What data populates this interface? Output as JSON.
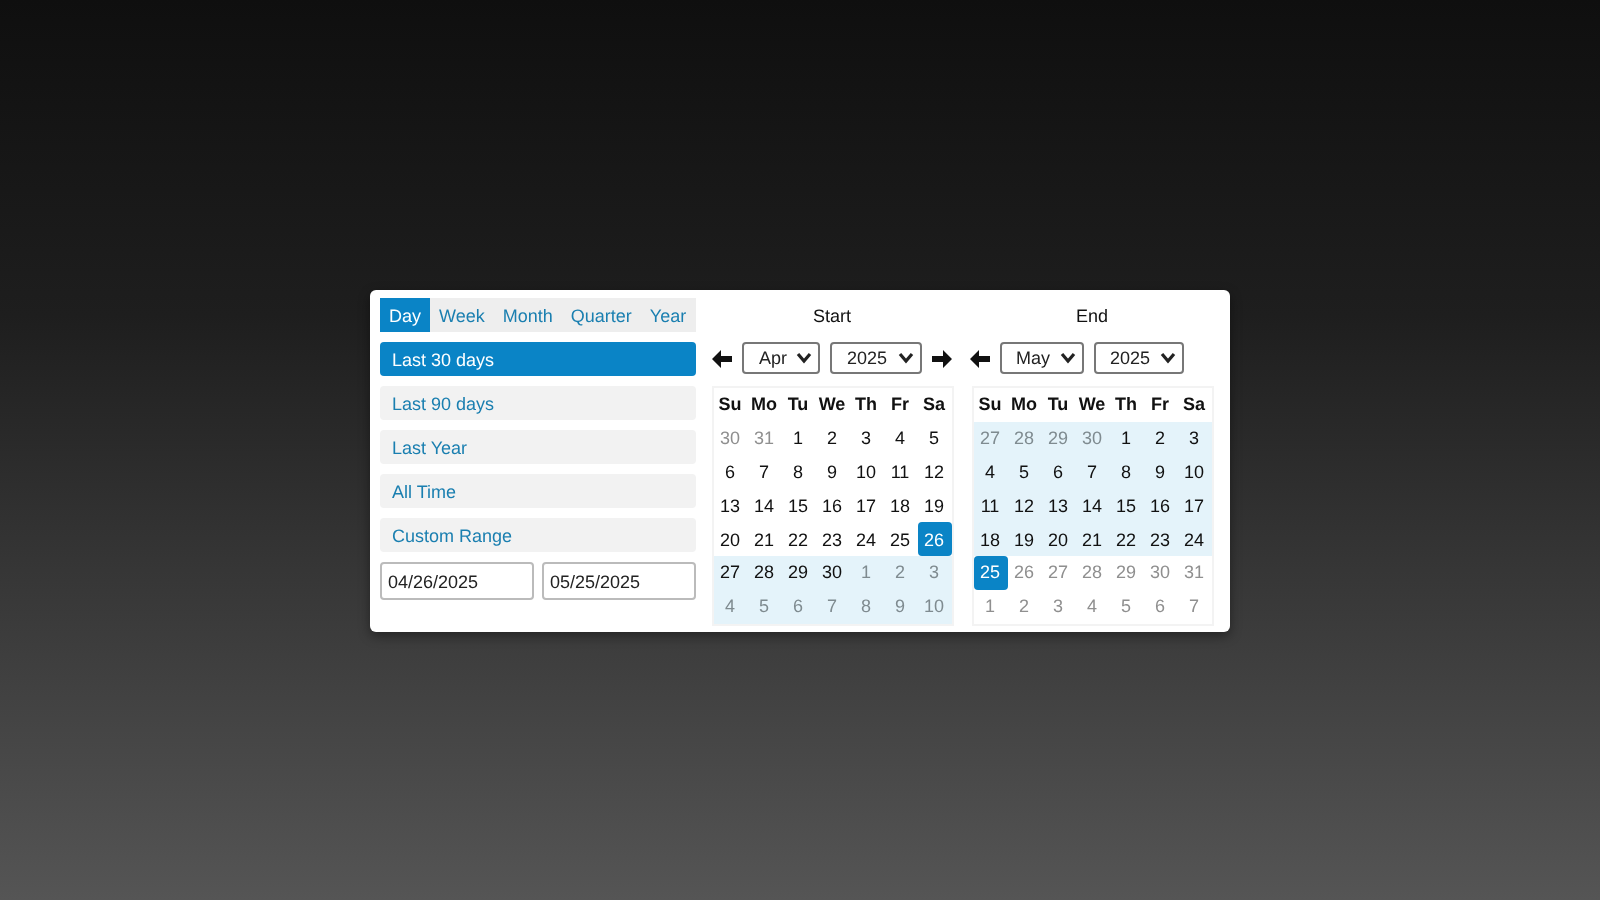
{
  "tabs": [
    {
      "label": "Day",
      "selected": true
    },
    {
      "label": "Week",
      "selected": false
    },
    {
      "label": "Month",
      "selected": false
    },
    {
      "label": "Quarter",
      "selected": false
    },
    {
      "label": "Year",
      "selected": false
    }
  ],
  "ranges": [
    {
      "label": "Last 30 days",
      "selected": true
    },
    {
      "label": "Last 90 days",
      "selected": false
    },
    {
      "label": "Last Year",
      "selected": false
    },
    {
      "label": "All Time",
      "selected": false
    },
    {
      "label": "Custom Range",
      "selected": false
    }
  ],
  "start_input": {
    "value": "04/26/2025"
  },
  "end_input": {
    "value": "05/25/2025"
  },
  "calendars": [
    {
      "title": "Start",
      "month": "Apr",
      "year": "2025",
      "prev_arrow": true,
      "next_arrow": true,
      "weekdays": [
        "Su",
        "Mo",
        "Tu",
        "We",
        "Th",
        "Fr",
        "Sa"
      ],
      "days": [
        {
          "day": "30",
          "outside": true,
          "in_range": false,
          "selected": false
        },
        {
          "day": "31",
          "outside": true,
          "in_range": false,
          "selected": false
        },
        {
          "day": "1",
          "outside": false,
          "in_range": false,
          "selected": false
        },
        {
          "day": "2",
          "outside": false,
          "in_range": false,
          "selected": false
        },
        {
          "day": "3",
          "outside": false,
          "in_range": false,
          "selected": false
        },
        {
          "day": "4",
          "outside": false,
          "in_range": false,
          "selected": false
        },
        {
          "day": "5",
          "outside": false,
          "in_range": false,
          "selected": false
        },
        {
          "day": "6",
          "outside": false,
          "in_range": false,
          "selected": false
        },
        {
          "day": "7",
          "outside": false,
          "in_range": false,
          "selected": false
        },
        {
          "day": "8",
          "outside": false,
          "in_range": false,
          "selected": false
        },
        {
          "day": "9",
          "outside": false,
          "in_range": false,
          "selected": false
        },
        {
          "day": "10",
          "outside": false,
          "in_range": false,
          "selected": false
        },
        {
          "day": "11",
          "outside": false,
          "in_range": false,
          "selected": false
        },
        {
          "day": "12",
          "outside": false,
          "in_range": false,
          "selected": false
        },
        {
          "day": "13",
          "outside": false,
          "in_range": false,
          "selected": false
        },
        {
          "day": "14",
          "outside": false,
          "in_range": false,
          "selected": false
        },
        {
          "day": "15",
          "outside": false,
          "in_range": false,
          "selected": false
        },
        {
          "day": "16",
          "outside": false,
          "in_range": false,
          "selected": false
        },
        {
          "day": "17",
          "outside": false,
          "in_range": false,
          "selected": false
        },
        {
          "day": "18",
          "outside": false,
          "in_range": false,
          "selected": false
        },
        {
          "day": "19",
          "outside": false,
          "in_range": false,
          "selected": false
        },
        {
          "day": "20",
          "outside": false,
          "in_range": false,
          "selected": false
        },
        {
          "day": "21",
          "outside": false,
          "in_range": false,
          "selected": false
        },
        {
          "day": "22",
          "outside": false,
          "in_range": false,
          "selected": false
        },
        {
          "day": "23",
          "outside": false,
          "in_range": false,
          "selected": false
        },
        {
          "day": "24",
          "outside": false,
          "in_range": false,
          "selected": false
        },
        {
          "day": "25",
          "outside": false,
          "in_range": false,
          "selected": false
        },
        {
          "day": "26",
          "outside": false,
          "in_range": false,
          "selected": true
        },
        {
          "day": "27",
          "outside": false,
          "in_range": true,
          "selected": false
        },
        {
          "day": "28",
          "outside": false,
          "in_range": true,
          "selected": false
        },
        {
          "day": "29",
          "outside": false,
          "in_range": true,
          "selected": false
        },
        {
          "day": "30",
          "outside": false,
          "in_range": true,
          "selected": false
        },
        {
          "day": "1",
          "outside": true,
          "in_range": true,
          "selected": false
        },
        {
          "day": "2",
          "outside": true,
          "in_range": true,
          "selected": false
        },
        {
          "day": "3",
          "outside": true,
          "in_range": true,
          "selected": false
        },
        {
          "day": "4",
          "outside": true,
          "in_range": true,
          "selected": false
        },
        {
          "day": "5",
          "outside": true,
          "in_range": true,
          "selected": false
        },
        {
          "day": "6",
          "outside": true,
          "in_range": true,
          "selected": false
        },
        {
          "day": "7",
          "outside": true,
          "in_range": true,
          "selected": false
        },
        {
          "day": "8",
          "outside": true,
          "in_range": true,
          "selected": false
        },
        {
          "day": "9",
          "outside": true,
          "in_range": true,
          "selected": false
        },
        {
          "day": "10",
          "outside": true,
          "in_range": true,
          "selected": false
        }
      ]
    },
    {
      "title": "End",
      "month": "May",
      "year": "2025",
      "prev_arrow": true,
      "next_arrow": false,
      "weekdays": [
        "Su",
        "Mo",
        "Tu",
        "We",
        "Th",
        "Fr",
        "Sa"
      ],
      "days": [
        {
          "day": "27",
          "outside": true,
          "in_range": true,
          "selected": false
        },
        {
          "day": "28",
          "outside": true,
          "in_range": true,
          "selected": false
        },
        {
          "day": "29",
          "outside": true,
          "in_range": true,
          "selected": false
        },
        {
          "day": "30",
          "outside": true,
          "in_range": true,
          "selected": false
        },
        {
          "day": "1",
          "outside": false,
          "in_range": true,
          "selected": false
        },
        {
          "day": "2",
          "outside": false,
          "in_range": true,
          "selected": false
        },
        {
          "day": "3",
          "outside": false,
          "in_range": true,
          "selected": false
        },
        {
          "day": "4",
          "outside": false,
          "in_range": true,
          "selected": false
        },
        {
          "day": "5",
          "outside": false,
          "in_range": true,
          "selected": false
        },
        {
          "day": "6",
          "outside": false,
          "in_range": true,
          "selected": false
        },
        {
          "day": "7",
          "outside": false,
          "in_range": true,
          "selected": false
        },
        {
          "day": "8",
          "outside": false,
          "in_range": true,
          "selected": false
        },
        {
          "day": "9",
          "outside": false,
          "in_range": true,
          "selected": false
        },
        {
          "day": "10",
          "outside": false,
          "in_range": true,
          "selected": false
        },
        {
          "day": "11",
          "outside": false,
          "in_range": true,
          "selected": false
        },
        {
          "day": "12",
          "outside": false,
          "in_range": true,
          "selected": false
        },
        {
          "day": "13",
          "outside": false,
          "in_range": true,
          "selected": false
        },
        {
          "day": "14",
          "outside": false,
          "in_range": true,
          "selected": false
        },
        {
          "day": "15",
          "outside": false,
          "in_range": true,
          "selected": false
        },
        {
          "day": "16",
          "outside": false,
          "in_range": true,
          "selected": false
        },
        {
          "day": "17",
          "outside": false,
          "in_range": true,
          "selected": false
        },
        {
          "day": "18",
          "outside": false,
          "in_range": true,
          "selected": false
        },
        {
          "day": "19",
          "outside": false,
          "in_range": true,
          "selected": false
        },
        {
          "day": "20",
          "outside": false,
          "in_range": true,
          "selected": false
        },
        {
          "day": "21",
          "outside": false,
          "in_range": true,
          "selected": false
        },
        {
          "day": "22",
          "outside": false,
          "in_range": true,
          "selected": false
        },
        {
          "day": "23",
          "outside": false,
          "in_range": true,
          "selected": false
        },
        {
          "day": "24",
          "outside": false,
          "in_range": true,
          "selected": false
        },
        {
          "day": "25",
          "outside": false,
          "in_range": false,
          "selected": true
        },
        {
          "day": "26",
          "outside": true,
          "in_range": false,
          "selected": false
        },
        {
          "day": "27",
          "outside": true,
          "in_range": false,
          "selected": false
        },
        {
          "day": "28",
          "outside": true,
          "in_range": false,
          "selected": false
        },
        {
          "day": "29",
          "outside": true,
          "in_range": false,
          "selected": false
        },
        {
          "day": "30",
          "outside": true,
          "in_range": false,
          "selected": false
        },
        {
          "day": "31",
          "outside": true,
          "in_range": false,
          "selected": false
        },
        {
          "day": "1",
          "outside": true,
          "in_range": false,
          "selected": false
        },
        {
          "day": "2",
          "outside": true,
          "in_range": false,
          "selected": false
        },
        {
          "day": "3",
          "outside": true,
          "in_range": false,
          "selected": false
        },
        {
          "day": "4",
          "outside": true,
          "in_range": false,
          "selected": false
        },
        {
          "day": "5",
          "outside": true,
          "in_range": false,
          "selected": false
        },
        {
          "day": "6",
          "outside": true,
          "in_range": false,
          "selected": false
        },
        {
          "day": "7",
          "outside": true,
          "in_range": false,
          "selected": false
        }
      ]
    }
  ]
}
